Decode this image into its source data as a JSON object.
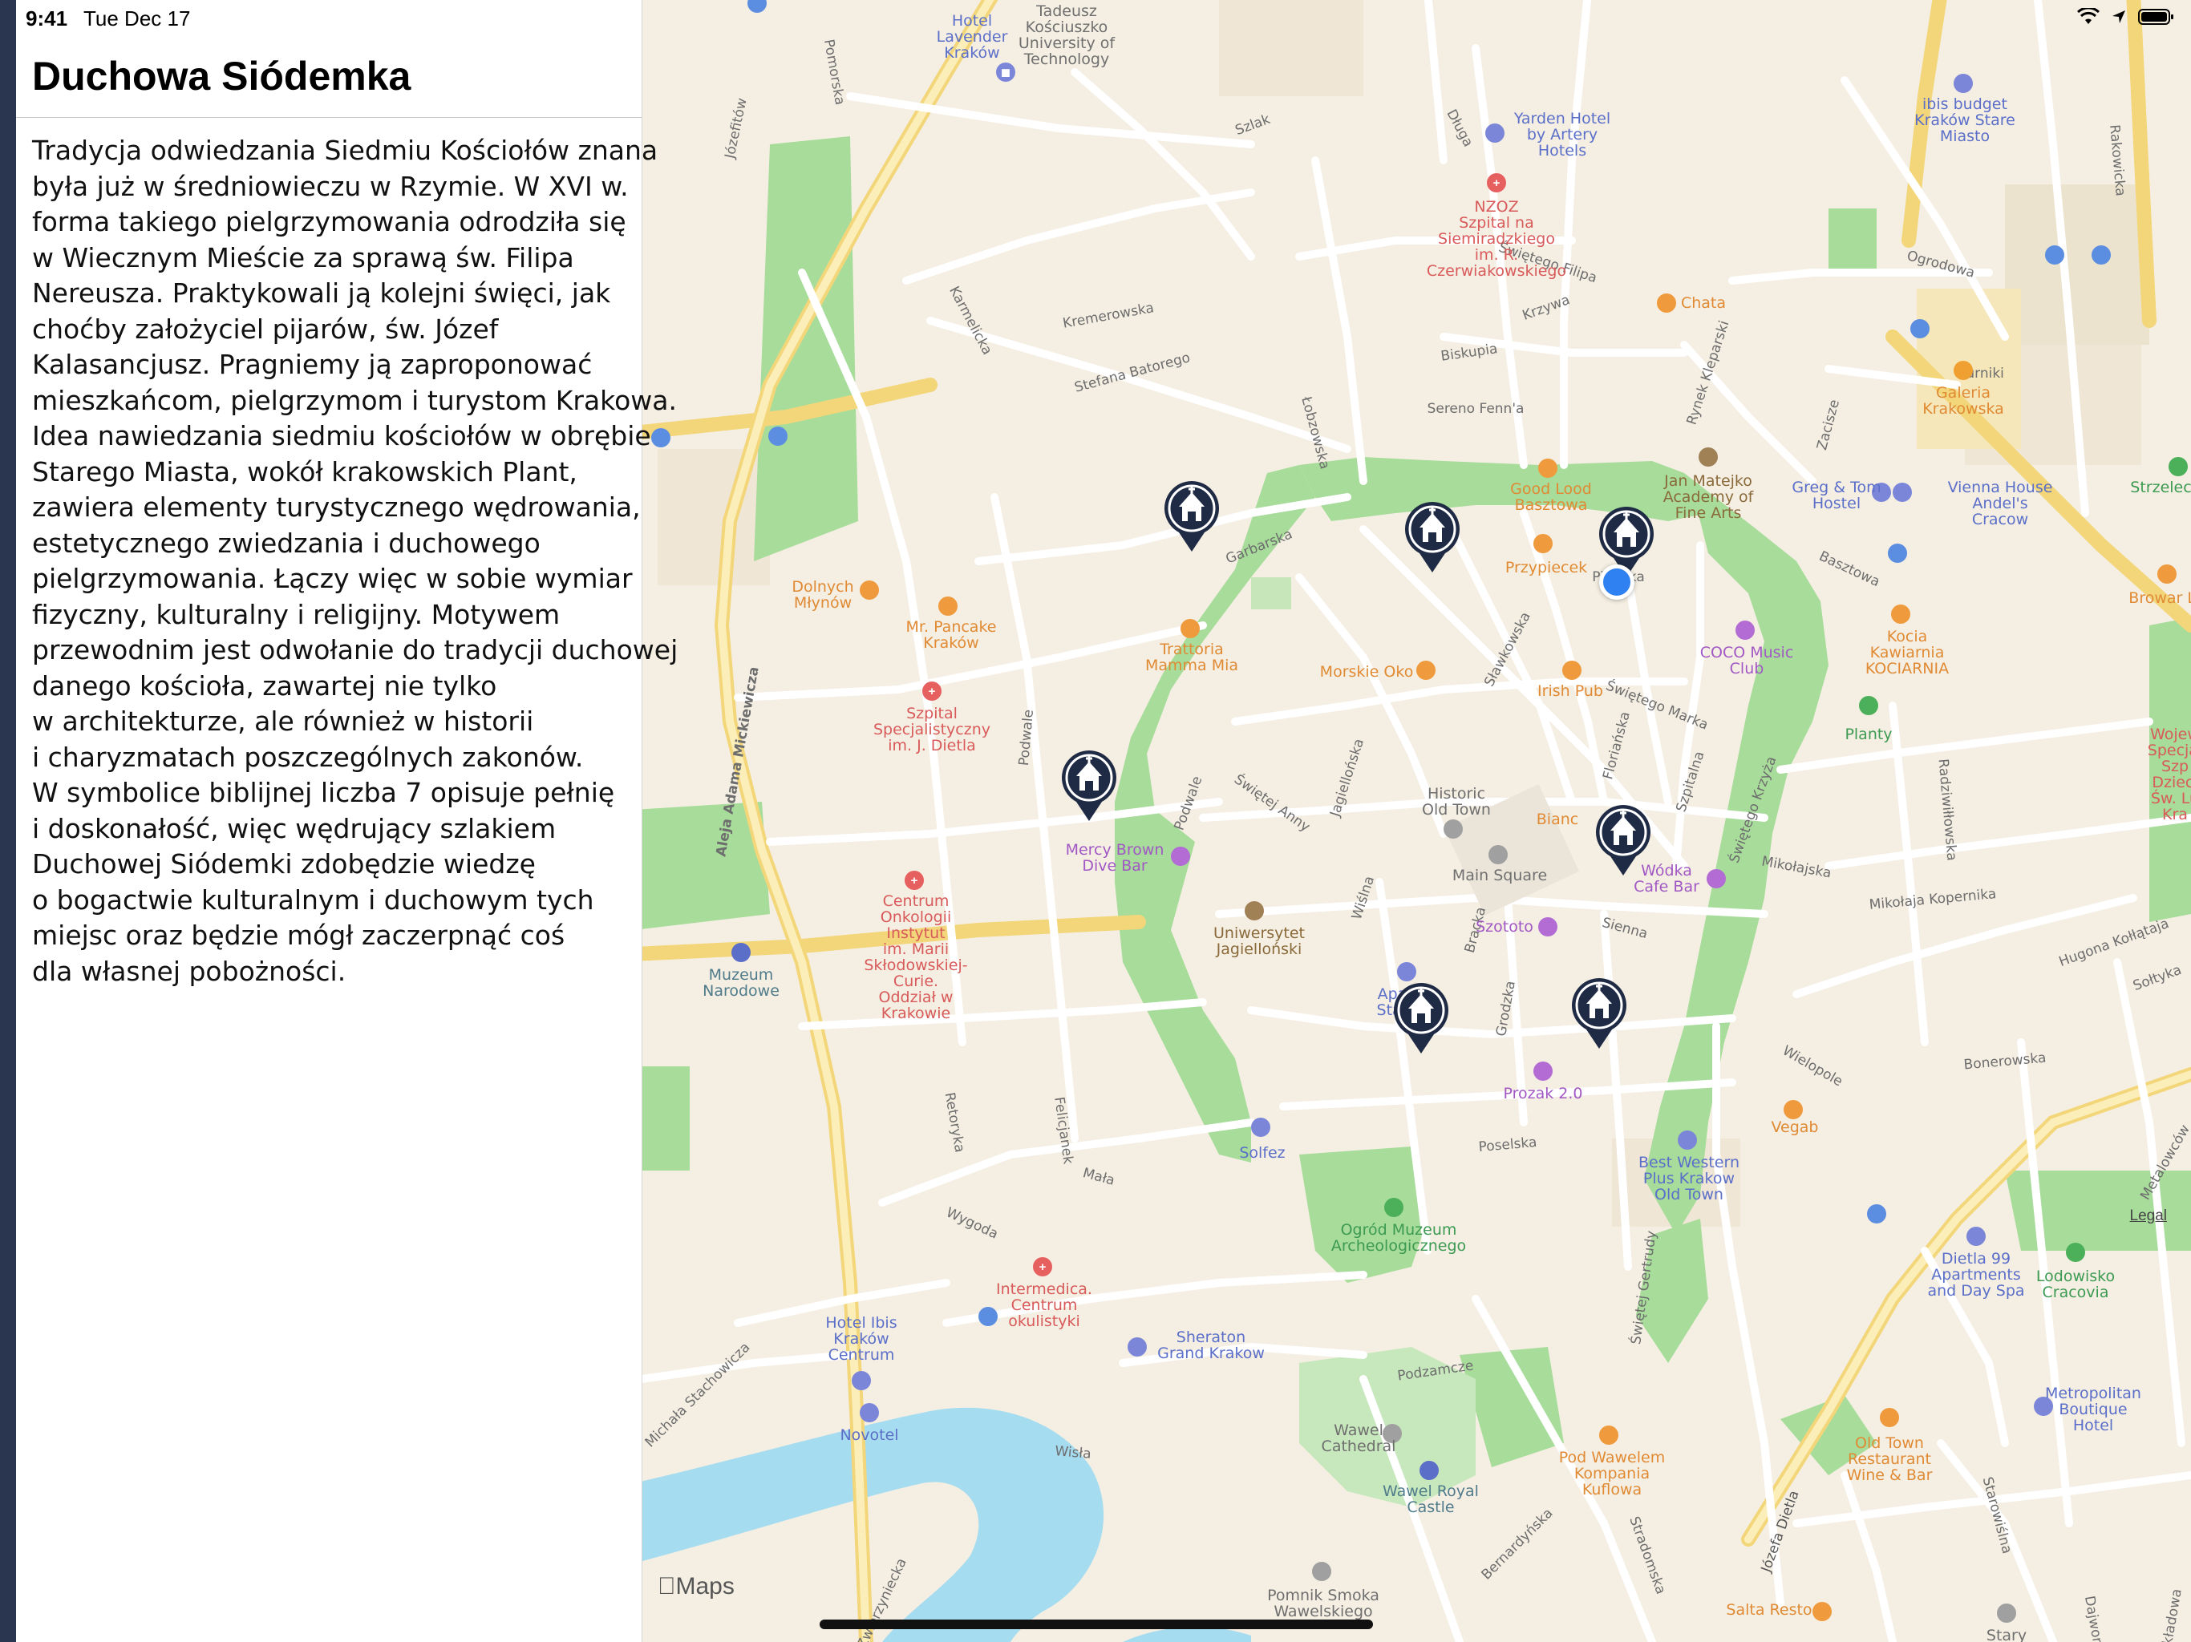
{
  "status_bar": {
    "time": "9:41",
    "date": "Tue Dec 17",
    "icons": [
      "wifi-icon",
      "location-arrow-icon",
      "battery-icon"
    ]
  },
  "panel": {
    "title": "Duchowa Siódemka",
    "body_lines": [
      "Tradycja odwiedzania Siedmiu Kościołów znana",
      "była już w średniowieczu w Rzymie. W XVI w.",
      "forma takiego pielgrzymowania odrodziła się",
      "w Wiecznym Mieście za sprawą św. Filipa",
      "Nereusza. Praktykowali ją kolejni święci, jak",
      "choćby założyciel pijarów, św. Józef",
      "Kalasancjusz. Pragniemy ją zaproponować",
      "mieszkańcom, pielgrzymom i turystom Krakowa.",
      "Idea nawiedzania siedmiu kościołów w obrębie",
      "Starego Miasta, wokół krakowskich Plant,",
      "zawiera elementy turystycznego wędrowania,",
      "estetycznego zwiedzania i duchowego",
      "pielgrzymowania. Łączy więc w sobie wymiar",
      "fizyczny, kulturalny i religijny. Motywem",
      "przewodnim jest odwołanie do tradycji duchowej",
      "danego kościoła, zawartej nie tylko",
      "w architekturze, ale również w historii",
      "i charyzmatach poszczególnych zakonów.",
      "W symbolice biblijnej liczba 7 opisuje pełnię",
      "i doskonałość, więc wędrujący szlakiem",
      "Duchowej Siódemki zdobędzie wiedzę",
      "o bogactwie kulturalnym i duchowym tych",
      "miejsc oraz będzie mógł zaczerpnąć coś",
      "dla własnej pobożności."
    ]
  },
  "map": {
    "attribution": "Maps",
    "legal": "Legal",
    "church_marker_icon": "church-icon",
    "church_marker_count": 7,
    "colors": {
      "land": "#f5efe3",
      "park": "#a7dc9a",
      "water": "#a6dcf0",
      "major_road": "#f6e08f",
      "minor_road": "#ffffff",
      "marker": "#1f2b45",
      "user_location": "#2f80f0"
    },
    "labels": {
      "hotel_lavender": "Hotel\nLavender\nKraków",
      "tadeusz": "Tadeusz\nKościuszko\nUniversity of\nTechnology",
      "ibis_budget": "ibis budget\nKraków Stare\nMiasto",
      "yarden": "Yarden Hotel\nby Artery\nHotels",
      "nzoz": "NZOZ\nSzpital na\nSiemiradzkiego\nim. R.\nCzerwiakowskiego",
      "chata": "Chata",
      "galeria": "Galeria\nKrakowska",
      "good_lood": "Good Lood\nBasztowa",
      "jan_matejko": "Jan Matejko\nAcademy of\nFine Arts",
      "greg_tom": "Greg & Tom\nHostel",
      "vienna_house": "Vienna House\nAndel's\nCracow",
      "strzelecki": "Strzeleck",
      "przypiecek": "Przypiecek",
      "browar": "Browar Lu",
      "dolnych": "Dolnych\nMłynów",
      "mr_pancake": "Mr. Pancake\nKraków",
      "trattoria": "Trattoria\nMamma Mia",
      "morskie_oko": "Morskie Oko",
      "irish_pub": "Irish Pub",
      "coco": "COCO Music\nClub",
      "kocia": "Kocia\nKawiarnia\nKOCIARNIA",
      "planty": "Planty",
      "szpital_dietla": "Szpital\nSpecjalistyczny\nim. J. Dietla",
      "wojew": "Wojew\nSpecjal\nSzp\nDzieci\nŚw. Lu\nKra",
      "historic": "Historic\nOld Town",
      "bianca": "Bianc",
      "wodka": "Wódka\nCafe Bar",
      "mercy_brown": "Mercy Brown\nDive Bar",
      "main_square": "Main Square",
      "centrum_onkologii": "Centrum\nOnkologii\nInstytut\nim. Marii\nSkłodowskiej-\nCurie.\nOddział w\nKrakowie",
      "szototo": "Szototo",
      "uniwersytet": "Uniwersytet\nJagielloński",
      "muzeum": "Muzeum\nNarodowe",
      "apart": "Apa\nStar",
      "prozak": "Prozak 2.0",
      "vegab": "Vegab",
      "solfez": "Solfez",
      "best_western": "Best Western\nPlus Krakow\nOld Town",
      "ogrod": "Ogród Muzeum\nArcheologicznego",
      "dietla99": "Dietla 99\nApartments\nand Day Spa",
      "lodowisko": "Lodowisko\nCracovia",
      "intermedica": "Intermedica.\nCentrum\nokulistyki",
      "hotel_ibis": "Hotel Ibis\nKraków\nCentrum",
      "sheraton": "Sheraton\nGrand Krakow",
      "novotel": "Novotel",
      "wawel_cathedral": "Wawel\nCathedral",
      "metropolitan": "Metropolitan\nBoutique\nHotel",
      "pod_wawelem": "Pod Wawelem\nKompania\nKuflowa",
      "old_town_rest": "Old Town\nRestaurant\nWine & Bar",
      "wawel_castle": "Wawel Royal\nCastle",
      "pomnik": "Pomnik Smoka\nWawelskiego",
      "salta": "Salta Resto",
      "stary": "Stary"
    },
    "streets": {
      "pomorska": "Pomorska",
      "jozefitow": "Józefitów",
      "szlak": "Szlak",
      "dluga": "Długa",
      "rakowicka": "Rakowicka",
      "swietego_filipa": "Świętego Filipa",
      "ogrodowa": "Ogrodowa",
      "karmelicka": "Karmelicka",
      "kremerowska": "Kremerowska",
      "krzywa": "Krzywa",
      "kurniki": "Kurniki",
      "biskupia": "Biskupia",
      "stefana_batorego": "Stefana Batorego",
      "sereno_fenna": "Sereno Fenn'a",
      "lobzowska": "Łobzowska",
      "rynek_kleparski": "Rynek Kleparski",
      "zacisze": "Zacisze",
      "garbarska": "Garbarska",
      "basztowa": "Basztowa",
      "pijarska": "Pijarska",
      "slawkowska": "Sławkowska",
      "swietego_marka": "Świętego Marka",
      "aleja_mickiewicza": "Aleja Adama Mickiewicza",
      "podwale": "Podwale",
      "swietej_anny": "Świętej Anny",
      "jagiellonska": "Jagiellońska",
      "florianska": "Floriańska",
      "szpitalna": "Szpitalna",
      "swietego_krzyza": "Świętego Krzyża",
      "mikolajska": "Mikołajska",
      "mikolaja_kopernika": "Mikołaja Kopernika",
      "radziwillowska": "Radziwiłłowska",
      "sienna": "Sienna",
      "wislna": "Wiślna",
      "bracka": "Bracka",
      "grodzka": "Grodzka",
      "hugona_kollataja": "Hugona Kołłątaja",
      "soltyka": "Sołtyka",
      "bonerowska": "Bonerowska",
      "wielopole": "Wielopole",
      "retoryka": "Retoryka",
      "felicjanek": "Felicjanek",
      "mala": "Mała",
      "poselska": "Poselska",
      "metalowcow": "Metalowców",
      "wygoda": "Wygoda",
      "swietej_gertrudy": "Świętej Gertrudy",
      "michala_stachowicza": "Michała Stachowicza",
      "podzamcze": "Podzamcze",
      "wisla": "Wisła",
      "bernardynska": "Bernardyńska",
      "stradomska": "Stradomska",
      "jozefa_dietla": "Józefa Dietla",
      "starowislna": "Starowiślna",
      "dajwor": "Dajwor",
      "zwierzyniecka": "Zwierzyniecka",
      "skladowa": "Składowa"
    }
  }
}
